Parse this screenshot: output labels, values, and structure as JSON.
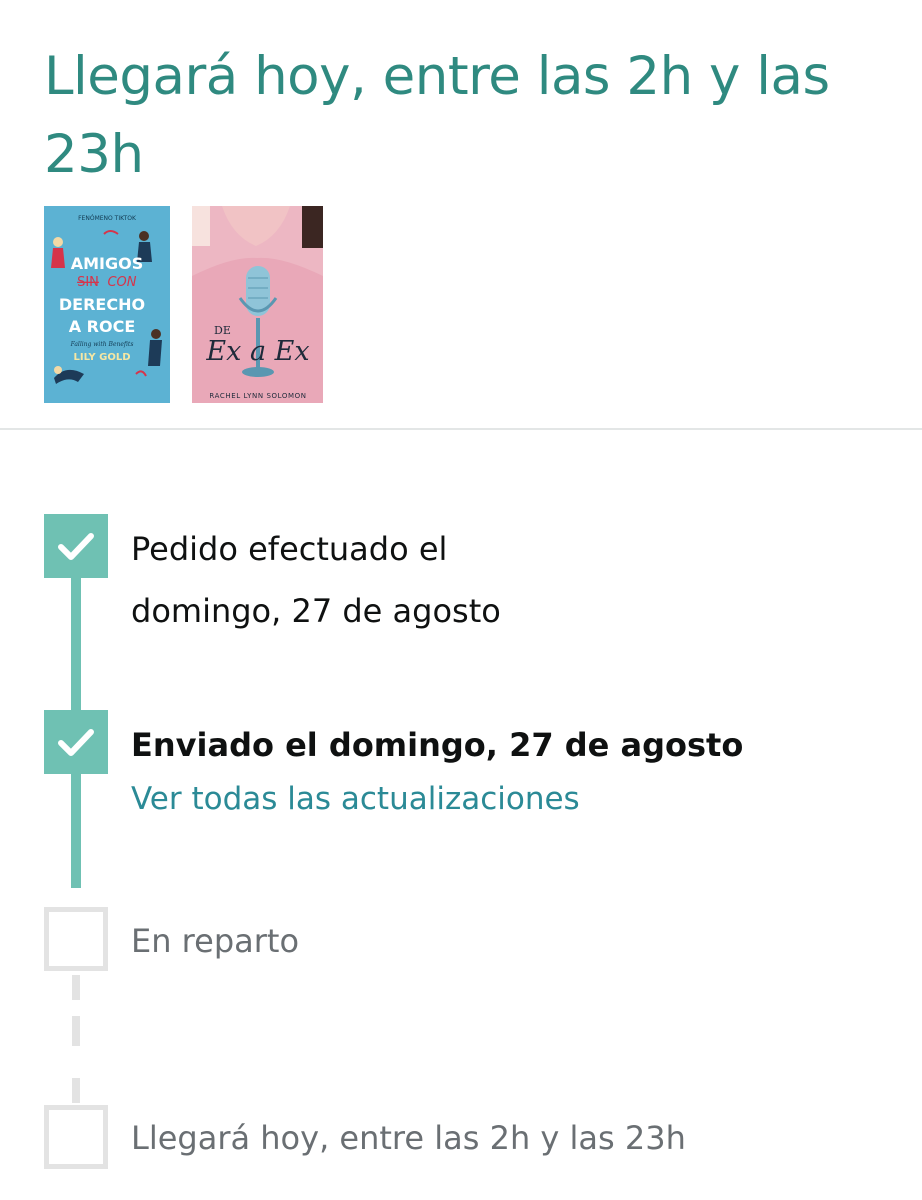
{
  "header": {
    "title": "Llegará hoy, entre las 2h y las 23h"
  },
  "items": [
    {
      "name": "book-cover-amigos-con-derecho-a-roce",
      "tag": "FENÓMENO TIKTOK",
      "title_lines": [
        "AMIGOS",
        "SIN",
        "CON",
        "DERECHO",
        "A ROCE"
      ],
      "subtitle": "Falling with Benefits",
      "author": "LILY GOLD",
      "colors": {
        "background": "#5cb2d3",
        "accent": "#d6344a"
      }
    },
    {
      "name": "book-cover-de-ex-a-ex",
      "title_prefix": "DE",
      "title_main": "Ex a Ex",
      "author": "RACHEL LYNN SOLOMON",
      "colors": {
        "background": "#edb7c3",
        "mic": "#8fc4d8"
      }
    }
  ],
  "timeline": {
    "steps": [
      {
        "status": "done",
        "lines": [
          "Pedido efectuado el",
          "domingo, 27 de agosto"
        ]
      },
      {
        "status": "done",
        "label": "Enviado el domingo, 27 de agosto",
        "link": "Ver todas las actualizaciones"
      },
      {
        "status": "pending",
        "label": "En reparto"
      },
      {
        "status": "pending",
        "label": "Llegará hoy, entre las 2h y las 23h"
      }
    ]
  },
  "colors": {
    "title": "#2f8a80",
    "progress": "#6fc1b3",
    "pending": "#e3e3e3",
    "link": "#2b8a96"
  },
  "icons": {
    "done": "checkmark-icon",
    "pending": "empty-checkbox-icon"
  }
}
